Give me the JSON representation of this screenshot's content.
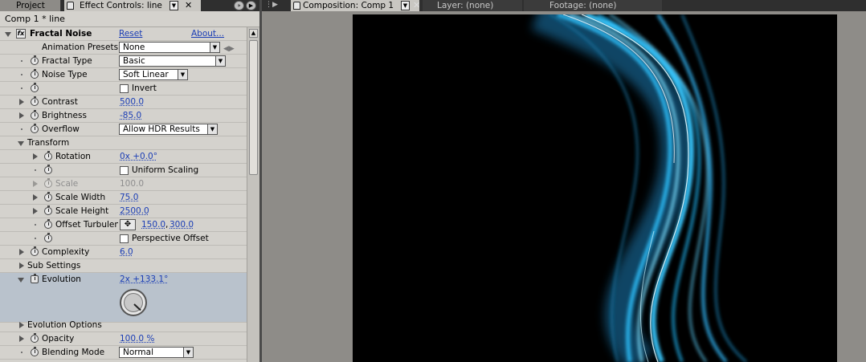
{
  "left_panel": {
    "tabs": {
      "project": "Project",
      "effect_controls": "Effect Controls: line"
    },
    "subheader": "Comp 1 * line",
    "effect": {
      "name": "Fractal Noise",
      "reset": "Reset",
      "about": "About...",
      "fx_glyph": "fx"
    },
    "rows": {
      "animation_presets": {
        "label": "Animation Presets:",
        "value": "None"
      },
      "fractal_type": {
        "label": "Fractal Type",
        "value": "Basic"
      },
      "noise_type": {
        "label": "Noise Type",
        "value": "Soft Linear"
      },
      "invert": {
        "label": "Invert"
      },
      "contrast": {
        "label": "Contrast",
        "value": "500.0"
      },
      "brightness": {
        "label": "Brightness",
        "value": "-85.0"
      },
      "overflow": {
        "label": "Overflow",
        "value": "Allow HDR Results"
      },
      "transform": {
        "label": "Transform"
      },
      "rotation": {
        "label": "Rotation",
        "value": "0x +0.0°"
      },
      "uniform_scaling": {
        "label": "Uniform Scaling"
      },
      "scale": {
        "label": "Scale",
        "value": "100.0"
      },
      "scale_width": {
        "label": "Scale Width",
        "value": "75.0"
      },
      "scale_height": {
        "label": "Scale Height",
        "value": "2500.0"
      },
      "offset_turbulence": {
        "label": "Offset Turbulen",
        "value_x": "150.0",
        "sep": ",",
        "value_y": "300.0"
      },
      "perspective_offset": {
        "label": "Perspective Offset"
      },
      "complexity": {
        "label": "Complexity",
        "value": "6.0"
      },
      "sub_settings": {
        "label": "Sub Settings"
      },
      "evolution": {
        "label": "Evolution",
        "value": "2x +133.1°"
      },
      "evolution_options": {
        "label": "Evolution Options"
      },
      "opacity": {
        "label": "Opacity",
        "value": "100.0 %"
      },
      "blending_mode": {
        "label": "Blending Mode",
        "value": "Normal"
      }
    }
  },
  "right_panel": {
    "tabs": {
      "composition": "Composition: Comp 1",
      "layer": "Layer: (none)",
      "footage": "Footage: (none)"
    }
  },
  "icons": [
    "lock-icon",
    "dropdown-arrow-icon",
    "close-icon",
    "panel-menu-icon",
    "twirl-icon",
    "stopwatch-icon",
    "fx-icon",
    "crosshair-icon",
    "dial-icon",
    "keyframe-nav-icon"
  ],
  "colors": {
    "panel_bg": "#d4d2cd",
    "value_blue": "#1a3db5",
    "evolution_highlight": "#b9c2cc",
    "viewer_bg": "#000000",
    "light_streak": "#39c8ff"
  }
}
